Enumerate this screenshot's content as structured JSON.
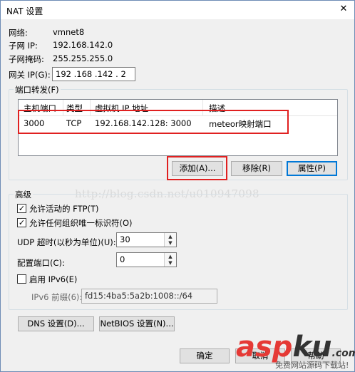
{
  "window": {
    "title": "NAT 设置",
    "close_glyph": "✕"
  },
  "info": {
    "network_label": "网络:",
    "network_value": "vmnet8",
    "subnet_ip_label": "子网 IP:",
    "subnet_ip_value": "192.168.142.0",
    "subnet_mask_label": "子网掩码:",
    "subnet_mask_value": "255.255.255.0",
    "gateway_label": "网关 IP(G):",
    "gateway_value": "192 .168 .142 . 2"
  },
  "port_forwarding": {
    "legend": "端口转发(F)",
    "columns": [
      "主机端口",
      "类型",
      "虚拟机 IP 地址",
      "描述"
    ],
    "rows": [
      {
        "host_port": "3000",
        "type": "TCP",
        "vm_ip": "192.168.142.128: 3000",
        "desc": "meteor映射端口"
      }
    ],
    "add_label": "添加(A)...",
    "remove_label": "移除(R)",
    "properties_label": "属性(P)"
  },
  "watermark": "http://blog.csdn.net/u010947098",
  "advanced": {
    "legend": "高级",
    "allow_active_ftp": "允许活动的 FTP(T)",
    "allow_any_oui": "允许任何组织唯一标识符(O)",
    "udp_timeout_label": "UDP 超时(以秒为单位)(U):",
    "udp_timeout_value": "30",
    "config_port_label": "配置端口(C):",
    "config_port_value": "0",
    "enable_ipv6": "启用 IPv6(E)",
    "ipv6_prefix_label": "IPv6 前缀(6):",
    "ipv6_prefix_value": "fd15:4ba5:5a2b:1008::/64"
  },
  "footer": {
    "dns_label": "DNS 设置(D)...",
    "netbios_label": "NetBIOS 设置(N)...",
    "ok_label": "确定",
    "cancel_label": "取消",
    "help_label": "帮助"
  },
  "brand": {
    "part1": "asp",
    "part2": "ku",
    "suffix": ".com",
    "sub": "免费网站源码下载站!"
  },
  "colors": {
    "highlight": "#e02020",
    "accent": "#0078d7"
  }
}
